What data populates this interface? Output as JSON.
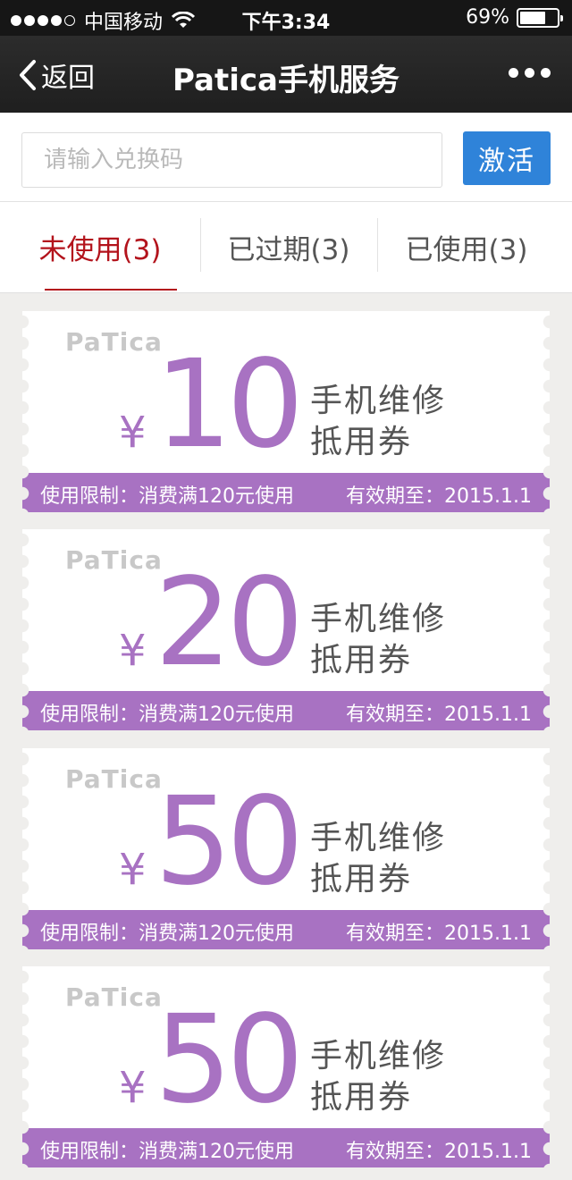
{
  "status_bar": {
    "carrier": "中国移动",
    "time": "下午3:34",
    "battery": "69%",
    "battery_level": 0.69
  },
  "nav": {
    "back_label": "返回",
    "title": "Patica手机服务"
  },
  "redeem": {
    "placeholder": "请输入兑换码",
    "value": "",
    "activate_label": "激活",
    "activate_color": "#2f83d9"
  },
  "tabs": [
    {
      "label": "未使用(3)",
      "active": true
    },
    {
      "label": "已过期(3)",
      "active": false
    },
    {
      "label": "已使用(3)",
      "active": false
    }
  ],
  "colors": {
    "accent": "#a872c2",
    "active_tab": "#b3131c"
  },
  "coupons": [
    {
      "brand": "PaTica",
      "currency": "¥",
      "amount": "10",
      "desc_line1": "手机维修",
      "desc_line2": "抵用券",
      "limit": "使用限制：消费满120元使用",
      "expiry": "有效期至：2015.1.1"
    },
    {
      "brand": "PaTica",
      "currency": "¥",
      "amount": "20",
      "desc_line1": "手机维修",
      "desc_line2": "抵用券",
      "limit": "使用限制：消费满120元使用",
      "expiry": "有效期至：2015.1.1"
    },
    {
      "brand": "PaTica",
      "currency": "¥",
      "amount": "50",
      "desc_line1": "手机维修",
      "desc_line2": "抵用券",
      "limit": "使用限制：消费满120元使用",
      "expiry": "有效期至：2015.1.1"
    },
    {
      "brand": "PaTica",
      "currency": "¥",
      "amount": "50",
      "desc_line1": "手机维修",
      "desc_line2": "抵用券",
      "limit": "使用限制：消费满120元使用",
      "expiry": "有效期至：2015.1.1"
    }
  ]
}
